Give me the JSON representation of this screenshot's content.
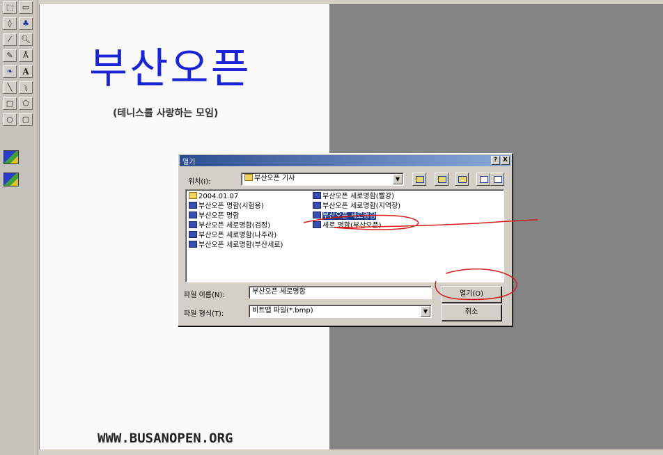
{
  "toolbox": {
    "tools": [
      {
        "icon": "select-icon",
        "glyph": "⬚"
      },
      {
        "icon": "rect-select-icon",
        "glyph": "▭"
      },
      {
        "icon": "eraser-icon",
        "glyph": "◊"
      },
      {
        "icon": "fill-icon",
        "glyph": "♣"
      },
      {
        "icon": "picker-icon",
        "glyph": "⁄"
      },
      {
        "icon": "magnifier-icon",
        "glyph": "🔍︎"
      },
      {
        "icon": "pencil-icon",
        "glyph": "✎"
      },
      {
        "icon": "brush-icon",
        "glyph": "Å"
      },
      {
        "icon": "airbrush-icon",
        "glyph": "❧"
      },
      {
        "icon": "text-icon",
        "glyph": "A"
      },
      {
        "icon": "line-icon",
        "glyph": "╲"
      },
      {
        "icon": "curve-icon",
        "glyph": "ʅ"
      },
      {
        "icon": "rectangle-icon",
        "glyph": "□"
      },
      {
        "icon": "polygon-icon",
        "glyph": "⬠"
      },
      {
        "icon": "ellipse-icon",
        "glyph": "○"
      },
      {
        "icon": "rounded-rect-icon",
        "glyph": "▢"
      }
    ]
  },
  "canvas": {
    "title": "부산오픈",
    "subtitle": "(테니스를 사랑하는 모임)",
    "url": "WWW.BUSANOPEN.ORG"
  },
  "dialog": {
    "title": "열기",
    "help_label": "?",
    "close_label": "X",
    "location_label": "위치(I):",
    "location_value": "부산오픈 기사",
    "files": [
      {
        "name": "2004.01.07",
        "type": "folder"
      },
      {
        "name": "부산오픈 명함(시험용)",
        "type": "file"
      },
      {
        "name": "부산오픈 명함",
        "type": "file"
      },
      {
        "name": "부산오픈 세로명함(검정)",
        "type": "file"
      },
      {
        "name": "부산오픈 세로명함(나주라)",
        "type": "file"
      },
      {
        "name": "부산오픈 세로명함(부산세로)",
        "type": "file"
      },
      {
        "name": "부산오픈 세로명함(빨강)",
        "type": "file"
      },
      {
        "name": "부산오픈 세로명함(지역장)",
        "type": "file"
      },
      {
        "name": "부산오픈 세로명함",
        "type": "file",
        "selected": true
      },
      {
        "name": "세로 명함(부산오픈)",
        "type": "file"
      }
    ],
    "filename_label": "파일 이름(N):",
    "filename_value": "부산오픈 세로명함",
    "filetype_label": "파일 형식(T):",
    "filetype_value": "비트맵 파일(*.bmp)",
    "open_button": "열기(O)",
    "cancel_button": "취소"
  },
  "colors": {
    "title_blue": "#1c25d6",
    "annotation_red": "#d81a1a",
    "dialog_face": "#d4d0c8",
    "workspace_grey": "#848484"
  }
}
